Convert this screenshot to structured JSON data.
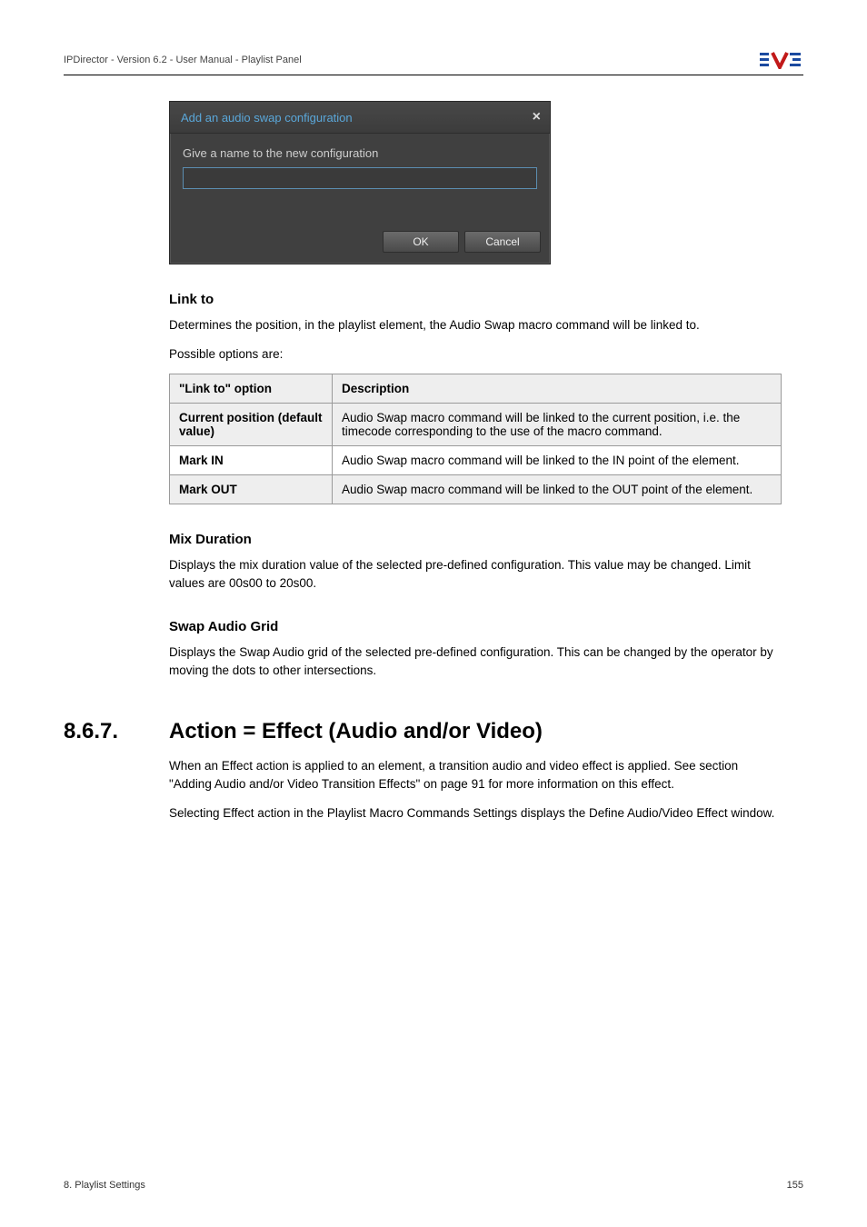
{
  "header": {
    "text": "IPDirector - Version 6.2 - User Manual - Playlist Panel"
  },
  "dialog": {
    "title": "Add an audio swap configuration",
    "label": "Give a name to the new configuration",
    "ok": "OK",
    "cancel": "Cancel"
  },
  "linkto": {
    "heading": "Link to",
    "para1": "Determines the position, in the playlist element, the Audio Swap macro command will be linked to.",
    "para2": "Possible options are:",
    "table": {
      "h1": "\"Link to\" option",
      "h2": "Description",
      "rows": [
        {
          "label": "Current position (default value)",
          "desc": "Audio Swap macro command will be linked to the current position, i.e. the timecode corresponding to the use of the macro command."
        },
        {
          "label": "Mark IN",
          "desc": "Audio Swap macro command will be linked to the IN point of the element."
        },
        {
          "label": "Mark OUT",
          "desc": "Audio Swap macro command will be linked to the OUT point of the element."
        }
      ]
    }
  },
  "mix": {
    "heading": "Mix Duration",
    "para": "Displays the mix duration value of the selected pre-defined configuration. This value may be changed. Limit values are 00s00 to 20s00."
  },
  "swap": {
    "heading": "Swap Audio Grid",
    "para": "Displays the Swap Audio grid of the selected pre-defined configuration. This can be changed by the operator by moving the dots to other intersections."
  },
  "section": {
    "num": "8.6.7.",
    "title": "Action = Effect (Audio and/or Video)",
    "para1": "When an Effect action is applied to an element, a transition audio and video effect is applied. See section \"Adding Audio and/or Video Transition Effects\" on page 91 for more information on this effect.",
    "para2": "Selecting Effect action in the Playlist Macro Commands Settings displays the Define Audio/Video Effect window."
  },
  "footer": {
    "left": "8. Playlist Settings",
    "right": "155"
  }
}
